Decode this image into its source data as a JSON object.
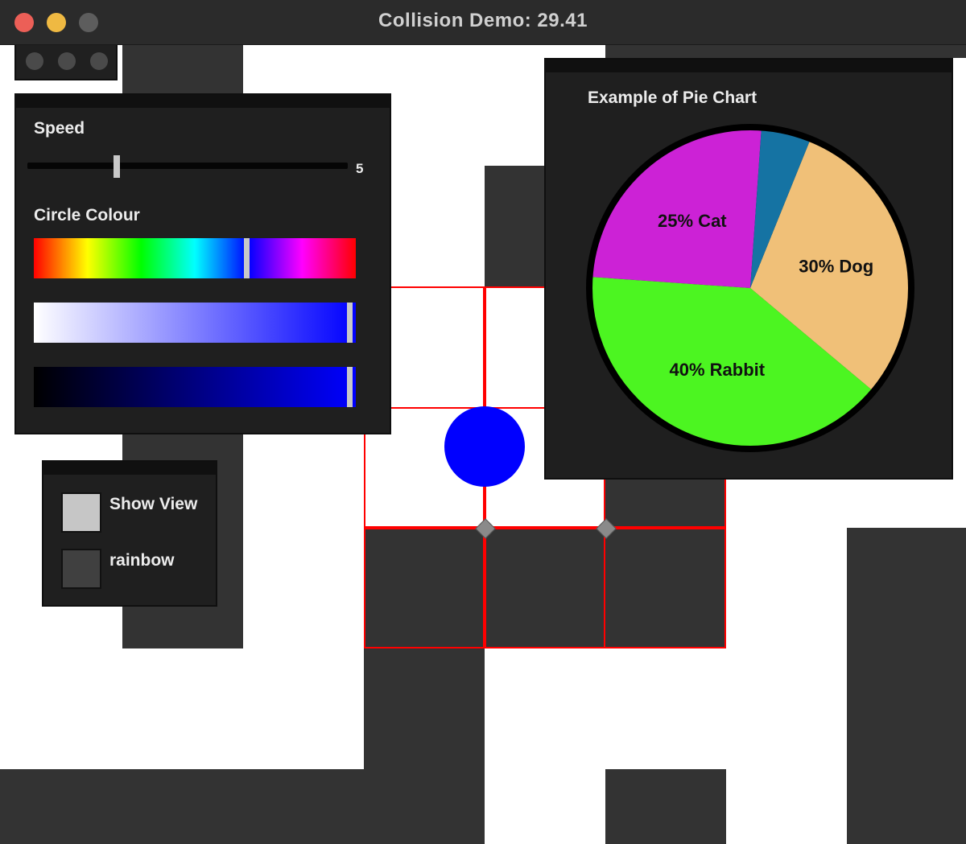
{
  "window": {
    "title": "Collision Demo: 29.41"
  },
  "speed_panel": {
    "speed_label": "Speed",
    "speed_value": "5",
    "speed_level": 0.28,
    "colour_label": "Circle Colour",
    "hue_position": 0.66,
    "saturation_position": 0.99,
    "brightness_position": 0.99
  },
  "options_panel": {
    "show_view_label": "Show View",
    "show_view_checked": true,
    "rainbow_label": "rainbow",
    "rainbow_checked": false
  },
  "pie_panel": {
    "title": "Example of Pie Chart"
  },
  "chart_data": {
    "type": "pie",
    "title": "Example of Pie Chart",
    "slices": [
      {
        "label": "Dog",
        "text": "30% Dog",
        "value": 30,
        "color": "#f0c078"
      },
      {
        "label": "Rabbit",
        "text": "40% Rabbit",
        "value": 40,
        "color": "#4cf521"
      },
      {
        "label": "Cat",
        "text": "25% Cat",
        "value": 25,
        "color": "#cc22d6"
      },
      {
        "label": "",
        "text": "",
        "value": 5,
        "color": "#1573a3"
      }
    ]
  },
  "colors": {
    "ball": "#0000ff",
    "wall": "#333333",
    "collision_grid": "#ff0000",
    "panel": "#1f1f1f"
  }
}
